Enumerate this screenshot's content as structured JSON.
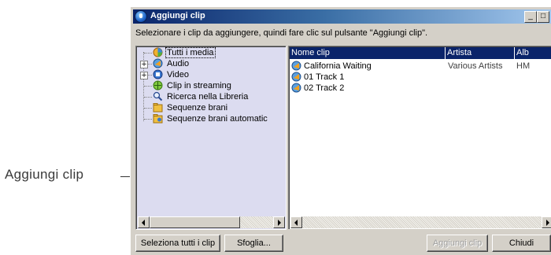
{
  "callout": {
    "label": "Aggiungi clip"
  },
  "window": {
    "title": "Aggiungi clip",
    "controls": {
      "minimize": "_",
      "maximize": "□",
      "close": "x"
    },
    "instructions": "Selezionare i clip da aggiungere, quindi fare clic sul pulsante \"Aggiungi clip\"."
  },
  "tree": {
    "items": [
      {
        "label": "Tutti i media",
        "icon": "all-media-icon",
        "selected": true
      },
      {
        "label": "Audio",
        "icon": "audio-icon",
        "expander": "+"
      },
      {
        "label": "Video",
        "icon": "video-icon",
        "expander": "+"
      },
      {
        "label": "Clip in streaming",
        "icon": "streaming-icon"
      },
      {
        "label": "Ricerca nella Libreria",
        "icon": "search-library-icon"
      },
      {
        "label": "Sequenze brani",
        "icon": "playlist-icon"
      },
      {
        "label": "Sequenze brani automatic",
        "icon": "auto-playlist-icon"
      }
    ]
  },
  "list": {
    "columns": [
      "Nome clip",
      "Artista",
      "Alb"
    ],
    "rows": [
      {
        "name": "California Waiting",
        "artist": "Various Artists",
        "album": "HM"
      },
      {
        "name": "01 Track 1",
        "artist": "",
        "album": ""
      },
      {
        "name": "02 Track 2",
        "artist": "",
        "album": ""
      }
    ]
  },
  "buttons": {
    "select_all": "Seleziona tutti i clip",
    "browse": "Sfoglia...",
    "add_clip": "Aggiungi clip",
    "close": "Chiudi"
  },
  "colors": {
    "title_active": "#0a246a",
    "face": "#d4d0c8",
    "tree_bg": "#dcdcf0"
  }
}
